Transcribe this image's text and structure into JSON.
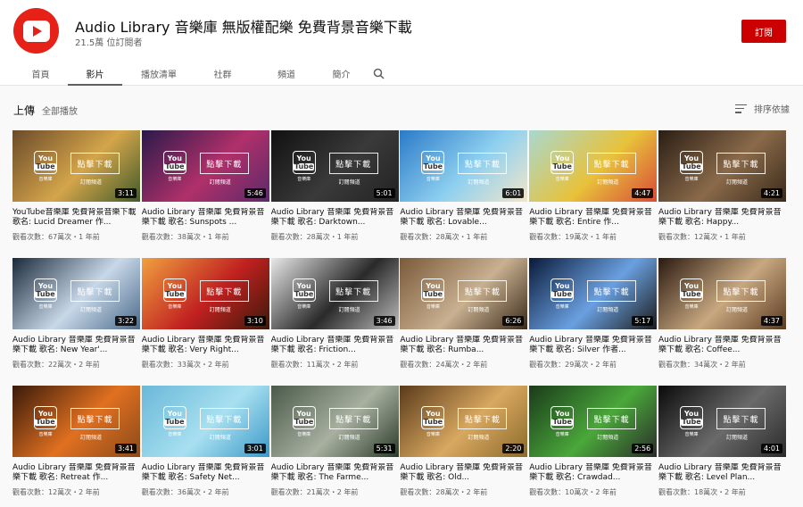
{
  "channel": {
    "title": "Audio Library 音樂庫 無版權配樂 免費背景音樂下載",
    "subscribers": "21.5萬 位訂閱者",
    "subscribe_label": "訂閱",
    "avatar_color": "#e62117",
    "subscribe_color": "#cc0000"
  },
  "tabs": [
    {
      "label": "首頁"
    },
    {
      "label": "影片"
    },
    {
      "label": "播放清單"
    },
    {
      "label": "社群"
    },
    {
      "label": "頻道"
    },
    {
      "label": "簡介"
    }
  ],
  "search_icon": "search-icon",
  "section": {
    "title": "上傳",
    "play_all": "全部播放",
    "sort_label": "排序依據"
  },
  "thumb_overlay": {
    "you": "You",
    "tube": "Tube",
    "lib_label": "音樂庫",
    "download_label": "點擊下載",
    "subscribe_label": "訂閱頻道"
  },
  "videos": [
    {
      "title": "YouTube音樂庫 免費背景音樂下載 歌名: Lucid Dreamer 作...",
      "meta": "觀看次數：67萬次・1 年前",
      "duration": "3:11",
      "colors": [
        "#6b4a2a",
        "#d4a54a",
        "#3f5a2a"
      ]
    },
    {
      "title": "Audio Library 音樂庫 免費背景音樂下載 歌名: Sunspots ...",
      "meta": "觀看次數：38萬次・1 年前",
      "duration": "5:46",
      "colors": [
        "#2a1a4a",
        "#b0306a",
        "#5a2a6a"
      ]
    },
    {
      "title": "Audio Library 音樂庫 免費背景音樂下載 歌名: Darktown...",
      "meta": "觀看次數：28萬次・1 年前",
      "duration": "5:01",
      "colors": [
        "#111111",
        "#3a3a3a",
        "#222222"
      ]
    },
    {
      "title": "Audio Library 音樂庫 免費背景音樂下載 歌名: Lovable...",
      "meta": "觀看次數：28萬次・1 年前",
      "duration": "6:01",
      "colors": [
        "#2a7ac8",
        "#8fd0f0",
        "#f2e6c8"
      ]
    },
    {
      "title": "Audio Library 音樂庫 免費背景音樂下載 歌名: Entire 作...",
      "meta": "觀看次數：19萬次・1 年前",
      "duration": "4:47",
      "colors": [
        "#a8d8d0",
        "#e8c23a",
        "#d84a3a"
      ]
    },
    {
      "title": "Audio Library 音樂庫 免費背景音樂下載 歌名: Happy...",
      "meta": "觀看次數：12萬次・1 年前",
      "duration": "4:21",
      "colors": [
        "#2a1e14",
        "#8a6a4a",
        "#3a2a1a"
      ]
    },
    {
      "title": "Audio Library 音樂庫 免費背景音樂下載 歌名: New Year'...",
      "meta": "觀看次數：22萬次・2 年前",
      "duration": "3:22",
      "colors": [
        "#1a2a3a",
        "#c8d8e8",
        "#4a6a8a"
      ]
    },
    {
      "title": "Audio Library 音樂庫 免費背景音樂下載 歌名: Very Right...",
      "meta": "觀看次數：33萬次・2 年前",
      "duration": "3:10",
      "colors": [
        "#f0a040",
        "#c02020",
        "#3a1a0a"
      ]
    },
    {
      "title": "Audio Library 音樂庫 免費背景音樂下載 歌名: Friction...",
      "meta": "觀看次數：11萬次・2 年前",
      "duration": "3:46",
      "colors": [
        "#e8e8e8",
        "#2a2a2a",
        "#bdbdbd"
      ]
    },
    {
      "title": "Audio Library 音樂庫 免費背景音樂下載 歌名: Rumba...",
      "meta": "觀看次數：24萬次・2 年前",
      "duration": "6:26",
      "colors": [
        "#7a5a3a",
        "#c8b090",
        "#3a2a1a"
      ]
    },
    {
      "title": "Audio Library 音樂庫 免費背景音樂下載 歌名: Silver 作者...",
      "meta": "觀看次數：29萬次・2 年前",
      "duration": "5:17",
      "colors": [
        "#0a1a3a",
        "#6aa0e0",
        "#1a1a1a"
      ]
    },
    {
      "title": "Audio Library 音樂庫 免費背景音樂下載 歌名: Coffee...",
      "meta": "觀看次數：34萬次・2 年前",
      "duration": "4:37",
      "colors": [
        "#2a1a10",
        "#c8a880",
        "#5a3a20"
      ]
    },
    {
      "title": "Audio Library 音樂庫 免費背景音樂下載 歌名: Retreat 作...",
      "meta": "觀看次數：12萬次・2 年前",
      "duration": "3:41",
      "colors": [
        "#3a1a0a",
        "#e07020",
        "#8a4a1a"
      ]
    },
    {
      "title": "Audio Library 音樂庫 免費背景音樂下載 歌名: Safety Net...",
      "meta": "觀看次數：36萬次・2 年前",
      "duration": "3:01",
      "colors": [
        "#6ab8d8",
        "#a8e0f0",
        "#3a98c8"
      ]
    },
    {
      "title": "Audio Library 音樂庫 免費背景音樂下載 歌名: The Farme...",
      "meta": "觀看次數：21萬次・2 年前",
      "duration": "5:31",
      "colors": [
        "#4a5a4a",
        "#a8b0a0",
        "#2a3a2a"
      ]
    },
    {
      "title": "Audio Library 音樂庫 免費背景音樂下載 歌名: Old...",
      "meta": "觀看次數：28萬次・2 年前",
      "duration": "2:20",
      "colors": [
        "#5a3a1a",
        "#d8a860",
        "#8a6a2a"
      ]
    },
    {
      "title": "Audio Library 音樂庫 免費背景音樂下載 歌名: Crawdad...",
      "meta": "觀看次數：10萬次・2 年前",
      "duration": "2:56",
      "colors": [
        "#1a3a1a",
        "#4aa83a",
        "#2a2a2a"
      ]
    },
    {
      "title": "Audio Library 音樂庫 免費背景音樂下載 歌名: Level Plan...",
      "meta": "觀看次數：18萬次・2 年前",
      "duration": "4:01",
      "colors": [
        "#0a0a0a",
        "#6a6a6a",
        "#2a2a2a"
      ]
    }
  ]
}
